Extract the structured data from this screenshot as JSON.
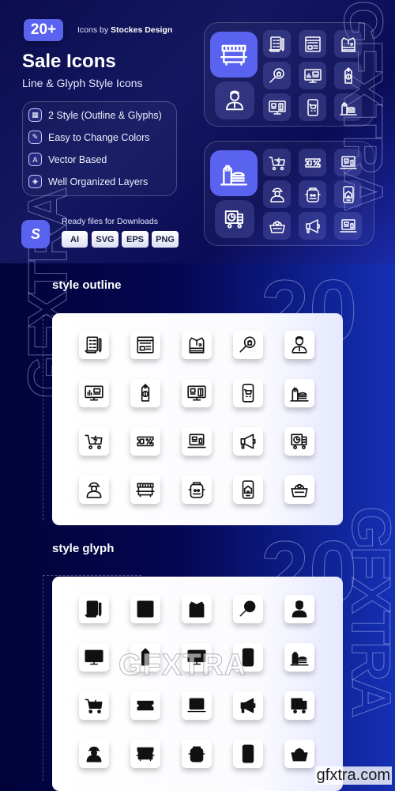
{
  "header": {
    "count_badge": "20+",
    "byline_prefix": "Icons by",
    "byline_brand": "Stockes Design",
    "title": "Sale Icons",
    "subtitle": "Line & Glyph Style Icons"
  },
  "features": [
    {
      "icon": "grid-icon",
      "label": "2 Style (Outline & Glyphs)"
    },
    {
      "icon": "brush-icon",
      "label": "Easy to Change Colors"
    },
    {
      "icon": "vector-icon",
      "label": "Vector Based"
    },
    {
      "icon": "layers-icon",
      "label": "Well Organized Layers"
    }
  ],
  "downloads": {
    "label": "Ready files for Downloads",
    "logo_glyph": "S",
    "formats": [
      "AI",
      "SVG",
      "EPS",
      "PNG"
    ]
  },
  "preview_panels": [
    {
      "featured": "market-stall-icon",
      "secondary": "salesman-icon",
      "grid": [
        "invoice-icon",
        "web-shop-icon",
        "shirt-icon",
        "search-bag-icon",
        "dashboard-icon",
        "price-tag-icon",
        "monitor-report-icon",
        "mobile-cart-icon",
        "fast-food-icon"
      ]
    },
    {
      "featured": "fast-food-icon",
      "secondary": "delivery-truck-icon",
      "grid": [
        "flash-sale-cart-icon",
        "coupon-icon",
        "laptop-shop-icon",
        "worker-icon",
        "backpack-icon",
        "mobile-home-icon",
        "basket-icon",
        "megaphone-icon",
        "laptop-shop-icon"
      ]
    }
  ],
  "sections": [
    {
      "title": "style outline",
      "style": "outline",
      "icons": [
        "invoice-icon",
        "web-shop-icon",
        "shirt-icon",
        "search-bag-icon",
        "salesman-icon",
        "dashboard-icon",
        "price-tag-icon",
        "monitor-report-icon",
        "mobile-cart-icon",
        "fast-food-icon",
        "flash-sale-cart-icon",
        "coupon-icon",
        "laptop-shop-icon",
        "megaphone-icon",
        "delivery-truck-icon",
        "worker-icon",
        "market-stall-icon",
        "backpack-icon",
        "mobile-home-icon",
        "basket-icon"
      ]
    },
    {
      "title": "style glyph",
      "style": "glyph",
      "icons": [
        "invoice-icon",
        "web-shop-icon",
        "shirt-icon",
        "search-bag-icon",
        "salesman-icon",
        "dashboard-icon",
        "price-tag-icon",
        "monitor-report-icon",
        "mobile-cart-icon",
        "fast-food-icon",
        "flash-sale-cart-icon",
        "coupon-icon",
        "laptop-shop-icon",
        "megaphone-icon",
        "delivery-truck-icon",
        "worker-icon",
        "market-stall-icon",
        "backpack-icon",
        "mobile-home-icon",
        "basket-icon"
      ]
    }
  ],
  "watermarks": {
    "vertical": "GFXTRA",
    "center": "GFXTRA",
    "corner": "gfxtra.com",
    "number": "20"
  },
  "colors": {
    "accent": "#5a63ef",
    "background": "#05063a",
    "card": "#ffffff",
    "icon_outline": "#1a1a1a"
  }
}
